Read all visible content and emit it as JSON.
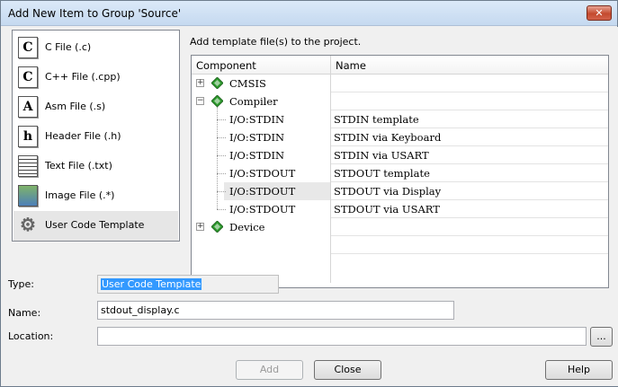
{
  "window": {
    "title": "Add New Item to Group 'Source'",
    "close_glyph": "✕"
  },
  "file_types": [
    {
      "label": "C File (.c)",
      "icon": "c-file-icon",
      "glyph": "C"
    },
    {
      "label": "C++ File (.cpp)",
      "icon": "cpp-file-icon",
      "glyph": "C"
    },
    {
      "label": "Asm File (.s)",
      "icon": "asm-file-icon",
      "glyph": "A"
    },
    {
      "label": "Header File (.h)",
      "icon": "header-file-icon",
      "glyph": "h"
    },
    {
      "label": "Text File (.txt)",
      "icon": "text-file-icon",
      "glyph": ""
    },
    {
      "label": "Image File (.*)",
      "icon": "image-file-icon",
      "glyph": ""
    },
    {
      "label": "User Code Template",
      "icon": "template-gear-icon",
      "glyph": "",
      "selected": true
    }
  ],
  "template_header": "Add template file(s) to the project.",
  "grid": {
    "columns": [
      "Component",
      "Name"
    ],
    "rows": [
      {
        "component": "CMSIS",
        "name": "",
        "kind": "group",
        "expander": "+"
      },
      {
        "component": "Compiler",
        "name": "",
        "kind": "group",
        "expander": "−"
      },
      {
        "component": "I/O:STDIN",
        "name": "STDIN template",
        "kind": "leaf"
      },
      {
        "component": "I/O:STDIN",
        "name": "STDIN via Keyboard",
        "kind": "leaf"
      },
      {
        "component": "I/O:STDIN",
        "name": "STDIN via USART",
        "kind": "leaf"
      },
      {
        "component": "I/O:STDOUT",
        "name": "STDOUT template",
        "kind": "leaf"
      },
      {
        "component": "I/O:STDOUT",
        "name": "STDOUT via Display",
        "kind": "leaf",
        "highlight": true
      },
      {
        "component": "I/O:STDOUT",
        "name": "STDOUT via USART",
        "kind": "leaf"
      },
      {
        "component": "Device",
        "name": "",
        "kind": "group",
        "expander": "+"
      }
    ]
  },
  "form": {
    "type_label": "Type:",
    "type_value": "User Code Template",
    "name_label": "Name:",
    "name_value": "stdout_display.c",
    "location_label": "Location:",
    "location_value": "",
    "browse_label": "..."
  },
  "buttons": {
    "add": "Add",
    "close": "Close",
    "help": "Help"
  },
  "colors": {
    "gem_green": "#2e9a2e",
    "selection_blue": "#3399ff"
  }
}
